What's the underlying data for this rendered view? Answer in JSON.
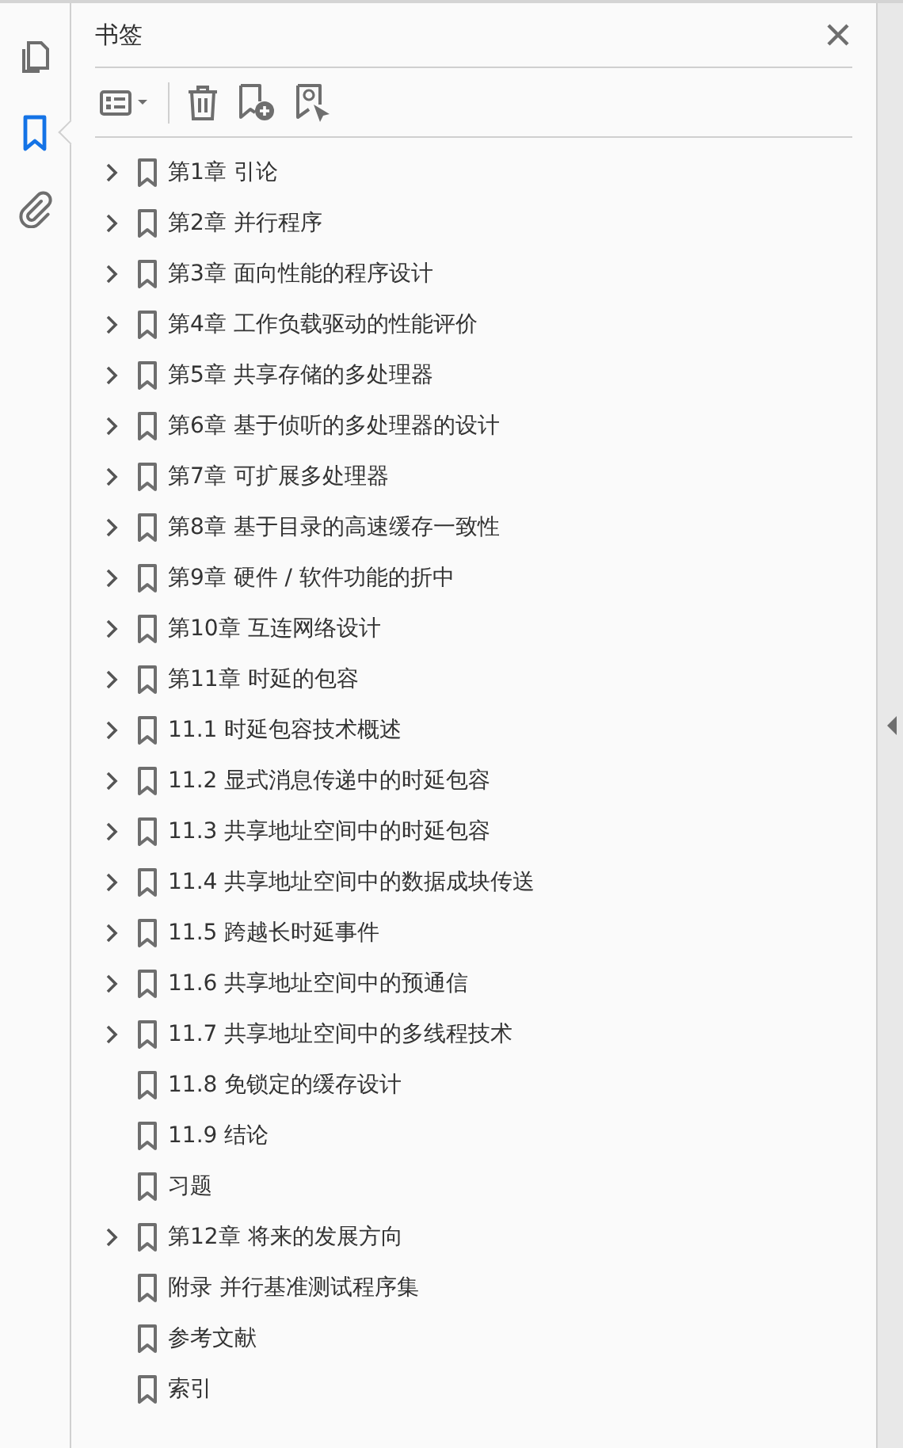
{
  "rail": [
    {
      "kind": "pages",
      "selected": false
    },
    {
      "kind": "bookmarks",
      "selected": true
    },
    {
      "kind": "attachments",
      "selected": false
    }
  ],
  "panel": {
    "title": "书签"
  },
  "bookmarks": [
    {
      "label": "第1章 引论",
      "expanded": false
    },
    {
      "label": "第2章 并行程序",
      "expanded": false
    },
    {
      "label": "第3章 面向性能的程序设计",
      "expanded": false
    },
    {
      "label": "第4章 工作负载驱动的性能评价",
      "expanded": false
    },
    {
      "label": "第5章 共享存储的多处理器",
      "expanded": false
    },
    {
      "label": "第6章 基于侦听的多处理器的设计",
      "expanded": false
    },
    {
      "label": "第7章 可扩展多处理器",
      "expanded": false
    },
    {
      "label": "第8章 基于目录的高速缓存一致性",
      "expanded": false
    },
    {
      "label": "第9章 硬件 / 软件功能的折中",
      "expanded": false
    },
    {
      "label": "第10章 互连网络设计",
      "expanded": false
    },
    {
      "label": "第11章 时延的包容",
      "expanded": false
    },
    {
      "label": "11.1 时延包容技术概述",
      "expanded": false
    },
    {
      "label": "11.2 显式消息传递中的时延包容",
      "expanded": false
    },
    {
      "label": "11.3 共享地址空间中的时延包容",
      "expanded": false
    },
    {
      "label": "11.4 共享地址空间中的数据成块传送",
      "expanded": false
    },
    {
      "label": "11.5 跨越长时延事件",
      "expanded": false
    },
    {
      "label": "11.6 共享地址空间中的预通信",
      "expanded": false
    },
    {
      "label": "11.7 共享地址空间中的多线程技术",
      "expanded": false
    },
    {
      "label": "11.8 免锁定的缓存设计"
    },
    {
      "label": "11.9 结论"
    },
    {
      "label": "习题"
    },
    {
      "label": "第12章 将来的发展方向",
      "expanded": false
    },
    {
      "label": "附录 并行基准测试程序集"
    },
    {
      "label": "参考文献"
    },
    {
      "label": "索引"
    }
  ]
}
